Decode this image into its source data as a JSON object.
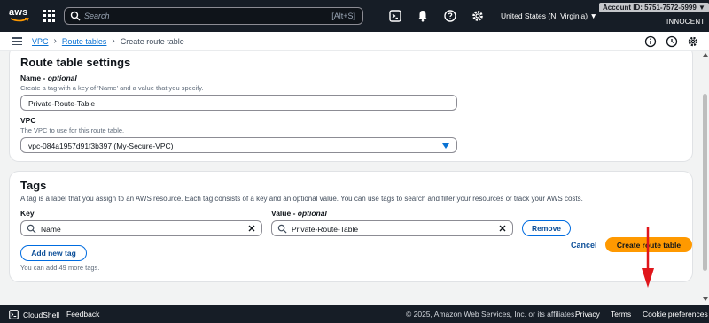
{
  "topnav": {
    "logo_text": "aws",
    "search_placeholder": "Search",
    "search_shortcut": "[Alt+S]",
    "region": "United States (N. Virginia) ▼",
    "account": "Account ID: 5751-7572-5999 ▼",
    "user": "INNOCENT"
  },
  "breadcrumb": {
    "items": [
      "VPC",
      "Route tables"
    ],
    "current": "Create route table"
  },
  "route_table_settings": {
    "heading": "Route table settings",
    "name_label": "Name",
    "name_optional": "optional",
    "name_desc": "Create a tag with a key of 'Name' and a value that you specify.",
    "name_value": "Private-Route-Table",
    "vpc_label": "VPC",
    "vpc_desc": "The VPC to use for this route table.",
    "vpc_value": "vpc-084a1957d91f3b397 (My-Secure-VPC)"
  },
  "tags": {
    "heading": "Tags",
    "desc": "A tag is a label that you assign to an AWS resource. Each tag consists of a key and an optional value. You can use tags to search and filter your resources or track your AWS costs.",
    "key_label": "Key",
    "value_label": "Value",
    "value_optional": "optional",
    "key_value": "Name",
    "value_value": "Private-Route-Table",
    "remove_label": "Remove",
    "add_label": "Add new tag",
    "remaining": "You can add 49 more tags."
  },
  "actions": {
    "cancel": "Cancel",
    "create": "Create route table"
  },
  "footer": {
    "cloudshell": "CloudShell",
    "feedback": "Feedback",
    "copyright": "© 2025, Amazon Web Services, Inc. or its affiliates.",
    "privacy": "Privacy",
    "terms": "Terms",
    "cookies": "Cookie preferences"
  },
  "colors": {
    "nav_bg": "#161d26",
    "link": "#0972d3",
    "primary_button": "#ff9900",
    "annotation_arrow": "#e0161b"
  }
}
